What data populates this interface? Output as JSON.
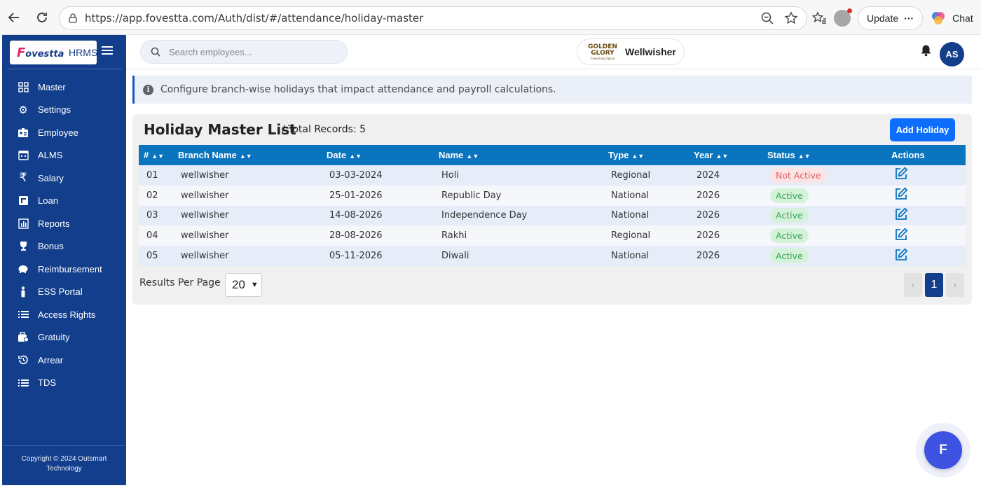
{
  "browser": {
    "url": "https://app.fovestta.com/Auth/dist/#/attendance/holiday-master",
    "update_label": "Update",
    "chat_label": "Chat"
  },
  "sidebar": {
    "brand_logo": "Fovestta",
    "brand_suffix": "HRMS",
    "items": [
      {
        "label": "Master",
        "icon": "grid-icon"
      },
      {
        "label": "Settings",
        "icon": "gear-icon"
      },
      {
        "label": "Employee",
        "icon": "id-card-icon"
      },
      {
        "label": "ALMS",
        "icon": "calendar-icon"
      },
      {
        "label": "Salary",
        "icon": "rupee-icon"
      },
      {
        "label": "Loan",
        "icon": "loan-icon"
      },
      {
        "label": "Reports",
        "icon": "chart-icon"
      },
      {
        "label": "Bonus",
        "icon": "trophy-icon"
      },
      {
        "label": "Reimbursement",
        "icon": "piggy-bank-icon"
      },
      {
        "label": "ESS Portal",
        "icon": "person-icon"
      },
      {
        "label": "Access Rights",
        "icon": "list-icon"
      },
      {
        "label": "Gratuity",
        "icon": "briefcase-icon"
      },
      {
        "label": "Arrear",
        "icon": "history-icon"
      },
      {
        "label": "TDS",
        "icon": "list-icon"
      }
    ],
    "copyright": "Copyright © 2024 Outsmart Technology"
  },
  "header": {
    "search_placeholder": "Search employees...",
    "org_logo_main": "GOLDEN GLORY",
    "org_logo_sub": "Coworking Space",
    "org_name": "Wellwisher",
    "user_initials": "AS"
  },
  "banner": {
    "text": "Configure branch-wise holidays that impact attendance and payroll calculations."
  },
  "card": {
    "title": "Holiday Master List",
    "subtitle": "/ Total Records: 5",
    "add_button": "Add Holiday"
  },
  "table": {
    "columns": [
      "#",
      "Branch Name",
      "Date",
      "Name",
      "Type",
      "Year",
      "Status",
      "Actions"
    ],
    "rows": [
      {
        "no": "01",
        "branch": "wellwisher",
        "date": "03-03-2024",
        "name": "Holi",
        "type": "Regional",
        "year": "2024",
        "status": "Not Active"
      },
      {
        "no": "02",
        "branch": "wellwisher",
        "date": "25-01-2026",
        "name": "Republic Day",
        "type": "National",
        "year": "2026",
        "status": "Active"
      },
      {
        "no": "03",
        "branch": "wellwisher",
        "date": "14-08-2026",
        "name": "Independence Day",
        "type": "National",
        "year": "2026",
        "status": "Active"
      },
      {
        "no": "04",
        "branch": "wellwisher",
        "date": "28-08-2026",
        "name": "Rakhi",
        "type": "Regional",
        "year": "2026",
        "status": "Active"
      },
      {
        "no": "05",
        "branch": "wellwisher",
        "date": "05-11-2026",
        "name": "Diwali",
        "type": "National",
        "year": "2026",
        "status": "Active"
      }
    ]
  },
  "pagination": {
    "results_label": "Results Per Page",
    "per_page": "20",
    "prev": "‹",
    "current_page": "1",
    "next": "›"
  },
  "fab": {
    "label": "F"
  },
  "colors": {
    "sidebar_bg": "#123e8c",
    "table_header": "#0a74be",
    "primary_button": "#0d6efd",
    "active_text": "#3aa55a",
    "inactive_text": "#e35b5b"
  }
}
